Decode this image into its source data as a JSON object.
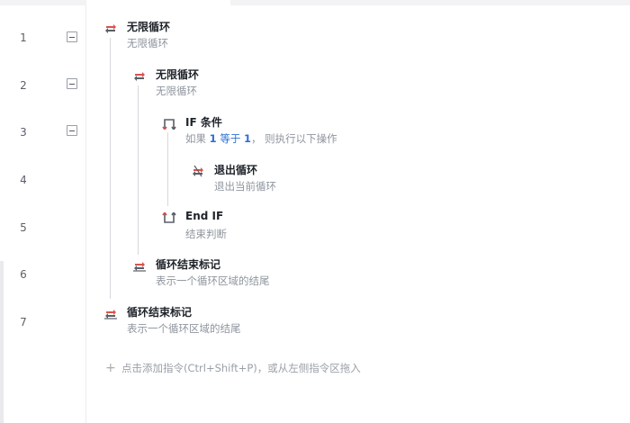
{
  "line_numbers": [
    "1",
    "2",
    "3",
    "4",
    "5",
    "6",
    "7"
  ],
  "steps": [
    {
      "title": "无限循环",
      "desc": "无限循环"
    },
    {
      "title": "无限循环",
      "desc": "无限循环"
    },
    {
      "title": "IF 条件",
      "desc_prefix": "如果 ",
      "desc_left": "1",
      "desc_op": " 等于 ",
      "desc_right": "1",
      "desc_suffix": "， 则执行以下操作"
    },
    {
      "title": "退出循环",
      "desc": "退出当前循环"
    },
    {
      "title": "End IF",
      "desc": "结束判断"
    },
    {
      "title": "循环结束标记",
      "desc": "表示一个循环区域的结尾"
    },
    {
      "title": "循环结束标记",
      "desc": "表示一个循环区域的结尾"
    }
  ],
  "add_hint": "点击添加指令(Ctrl+Shift+P)，或从左侧指令区拖入",
  "icons": {
    "loop": "loop-icon",
    "if": "if-branch-icon",
    "end_if": "end-if-icon",
    "break": "break-loop-icon",
    "loop_end": "loop-end-icon",
    "add": "plus-icon"
  },
  "colors": {
    "icon_red": "#d9534f",
    "number_blue": "#2b6fd6"
  }
}
